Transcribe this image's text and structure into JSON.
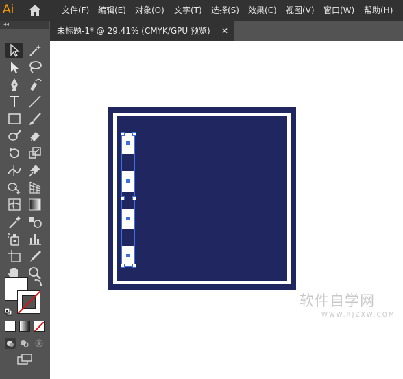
{
  "app": {
    "logo": "Ai"
  },
  "menu": [
    "文件(F)",
    "编辑(E)",
    "对象(O)",
    "文字(T)",
    "选择(S)",
    "效果(C)",
    "视图(V)",
    "窗口(W)",
    "帮助(H)"
  ],
  "toolbar": {
    "collapse_label": "◂◂"
  },
  "document": {
    "tab_title": "未标题-1* @ 29.41% (CMYK/GPU 预览)",
    "close_label": "✕"
  },
  "colors": {
    "frame_fill": "#1f2660",
    "selection": "#3f6ee0",
    "app_logo": "#ff9a00",
    "chrome_dark": "#323232",
    "chrome_mid": "#535353"
  },
  "tools": [
    [
      "selection-tool",
      "magic-wand-tool"
    ],
    [
      "direct-selection-tool",
      "lasso-tool"
    ],
    [
      "pen-tool",
      "curvature-tool"
    ],
    [
      "type-tool",
      "line-segment-tool"
    ],
    [
      "rectangle-tool",
      "paintbrush-tool"
    ],
    [
      "shaper-tool",
      "eraser-tool"
    ],
    [
      "rotate-tool",
      "scale-tool"
    ],
    [
      "width-tool",
      "puppet-warp-tool"
    ],
    [
      "shape-builder-tool",
      "perspective-grid-tool"
    ],
    [
      "mesh-tool",
      "gradient-tool"
    ],
    [
      "eyedropper-tool",
      "blend-tool"
    ],
    [
      "symbol-sprayer-tool",
      "column-graph-tool"
    ],
    [
      "artboard-tool",
      "slice-tool"
    ],
    [
      "hand-tool",
      "zoom-tool"
    ]
  ],
  "watermark": {
    "main": "软件自学网",
    "sub": "WWW.RJZXW.COM"
  }
}
